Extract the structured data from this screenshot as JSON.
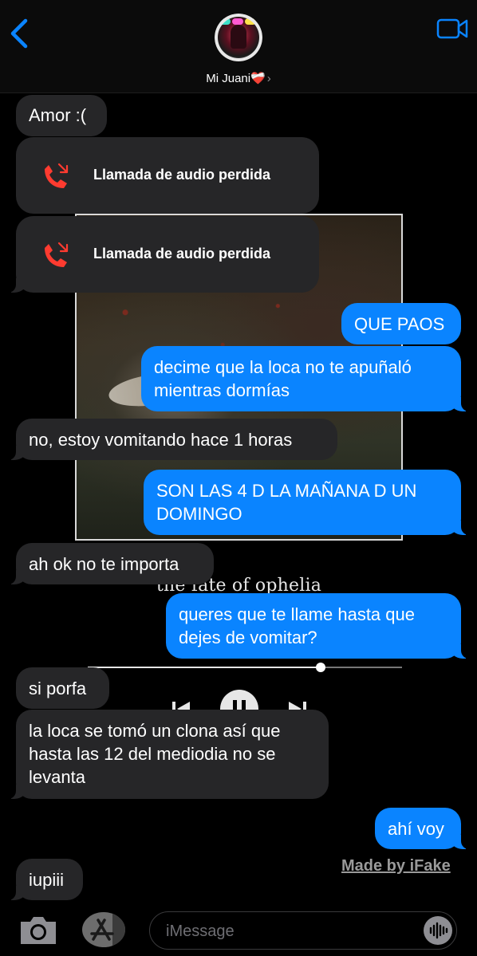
{
  "header": {
    "contact_name": "Mi Juani❤️‍🩹",
    "chevron": "›",
    "back_icon": "chevron-left-icon",
    "video_icon": "video-camera-icon"
  },
  "background_art": {
    "caption": "the fate of ophelia",
    "progress": 0.74
  },
  "messages": [
    {
      "from": "them",
      "text": "Amor :("
    },
    {
      "from": "them",
      "type": "call",
      "text": "Llamada de audio perdida"
    },
    {
      "from": "them",
      "type": "call",
      "text": "Llamada de audio perdida"
    },
    {
      "from": "me",
      "text": "QUE PAOS"
    },
    {
      "from": "me",
      "text": "decime que la loca no te apuñaló mientras dormías"
    },
    {
      "from": "them",
      "text": "no, estoy vomitando hace 1 horas"
    },
    {
      "from": "me",
      "text": "SON LAS 4 D LA MAÑANA D UN DOMINGO"
    },
    {
      "from": "them",
      "text": "ah ok no te importa"
    },
    {
      "from": "me",
      "text": "queres que te llame hasta que dejes de vomitar?"
    },
    {
      "from": "them",
      "text": "si porfa"
    },
    {
      "from": "them",
      "text": "la loca se tomó un clona así que hasta las 12 del mediodia no se levanta"
    },
    {
      "from": "me",
      "text": "ahí voy"
    },
    {
      "from": "them",
      "text": "iupiii"
    }
  ],
  "watermark": "Made by iFake",
  "input_bar": {
    "placeholder": "iMessage",
    "camera_icon": "camera-icon",
    "apps_icon": "app-store-icon",
    "audio_icon": "waveform-icon"
  },
  "colors": {
    "outgoing": "#0a84ff",
    "incoming": "#262628",
    "missed_call": "#ff3b30",
    "accent": "#0a84ff"
  }
}
